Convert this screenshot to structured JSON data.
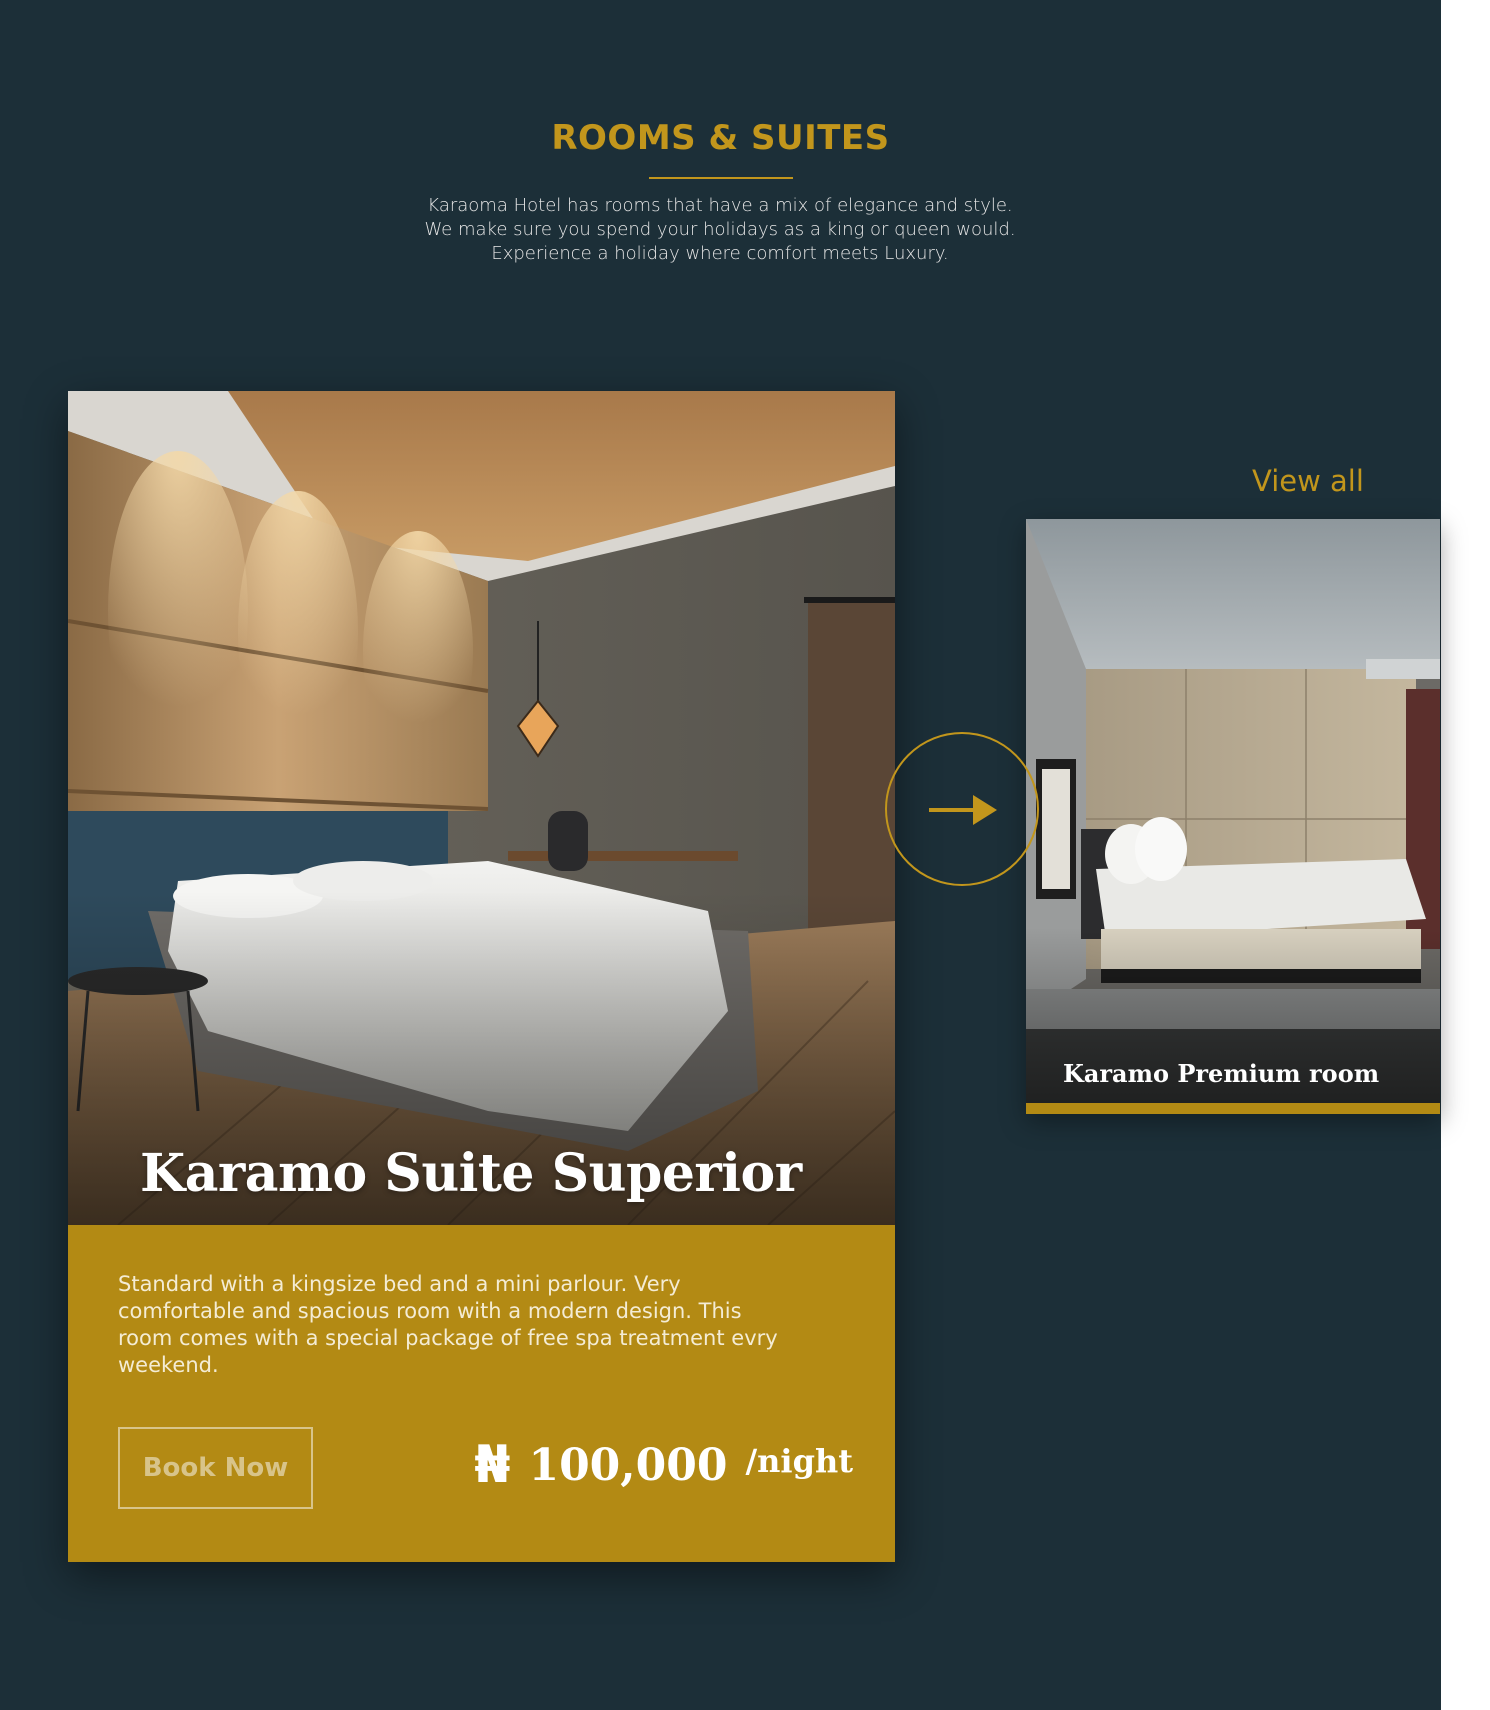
{
  "section": {
    "heading": "ROOMS & SUITES",
    "intro": "Karaoma Hotel has rooms that have a mix of elegance and style. We make sure  you spend your holidays as a king or queen would. Experience a holiday where comfort meets Luxury."
  },
  "featured_room": {
    "title": "Karamo Suite Superior",
    "description": "Standard with a kingsize bed and a mini parlour. Very comfortable and spacious room with a modern design. This room comes with a special package of free spa treatment evry weekend.",
    "book_label": "Book Now",
    "currency_symbol": "₦",
    "price": "100,000",
    "price_unit": "/night"
  },
  "side_panel": {
    "view_all_label": "View all",
    "next_room_title": "Karamo Premium room"
  },
  "icons": {
    "next": "arrow-right-icon",
    "currency": "naira-icon"
  },
  "colors": {
    "background": "#1c2f38",
    "accent": "#c2961c",
    "card_gold": "#b38a14",
    "text_light": "#e6e6e6"
  }
}
